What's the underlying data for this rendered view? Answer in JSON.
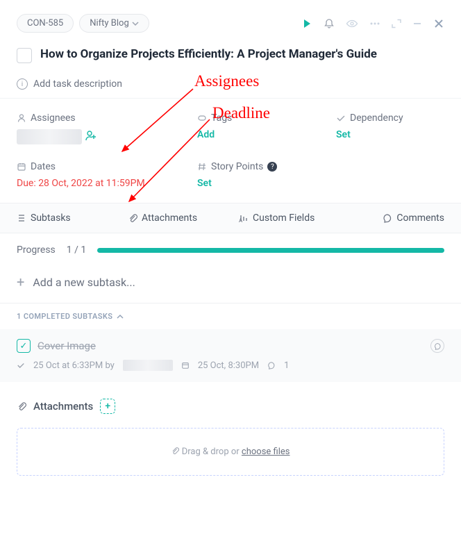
{
  "header": {
    "task_id": "CON-585",
    "project": "Nifty Blog"
  },
  "title": "How to Organize Projects Efficiently: A Project Manager's Guide",
  "desc_placeholder": "Add task description",
  "fields": {
    "assignees": {
      "label": "Assignees"
    },
    "tags": {
      "label": "Tags",
      "action": "Add"
    },
    "dependency": {
      "label": "Dependency",
      "action": "Set"
    },
    "dates": {
      "label": "Dates",
      "value": "Due: 28 Oct, 2022 at 11:59PM"
    },
    "story_points": {
      "label": "Story Points",
      "action": "Set"
    }
  },
  "tabs": {
    "subtasks": "Subtasks",
    "attachments": "Attachments",
    "custom_fields": "Custom Fields",
    "comments": "Comments"
  },
  "progress": {
    "label": "Progress",
    "count": "1 / 1"
  },
  "add_subtask": "Add a new subtask...",
  "completed_header": "1 COMPLETED SUBTASKS",
  "subtask": {
    "name": "Cover Image",
    "completed_at": "25 Oct at 6:33PM by",
    "due": "25 Oct, 8:30PM",
    "comments": "1"
  },
  "attachments": {
    "label": "Attachments",
    "drop_pre": "Drag & drop or ",
    "drop_link": "choose files"
  },
  "annotations": {
    "assignees": "Assignees",
    "deadline": "Deadline"
  }
}
